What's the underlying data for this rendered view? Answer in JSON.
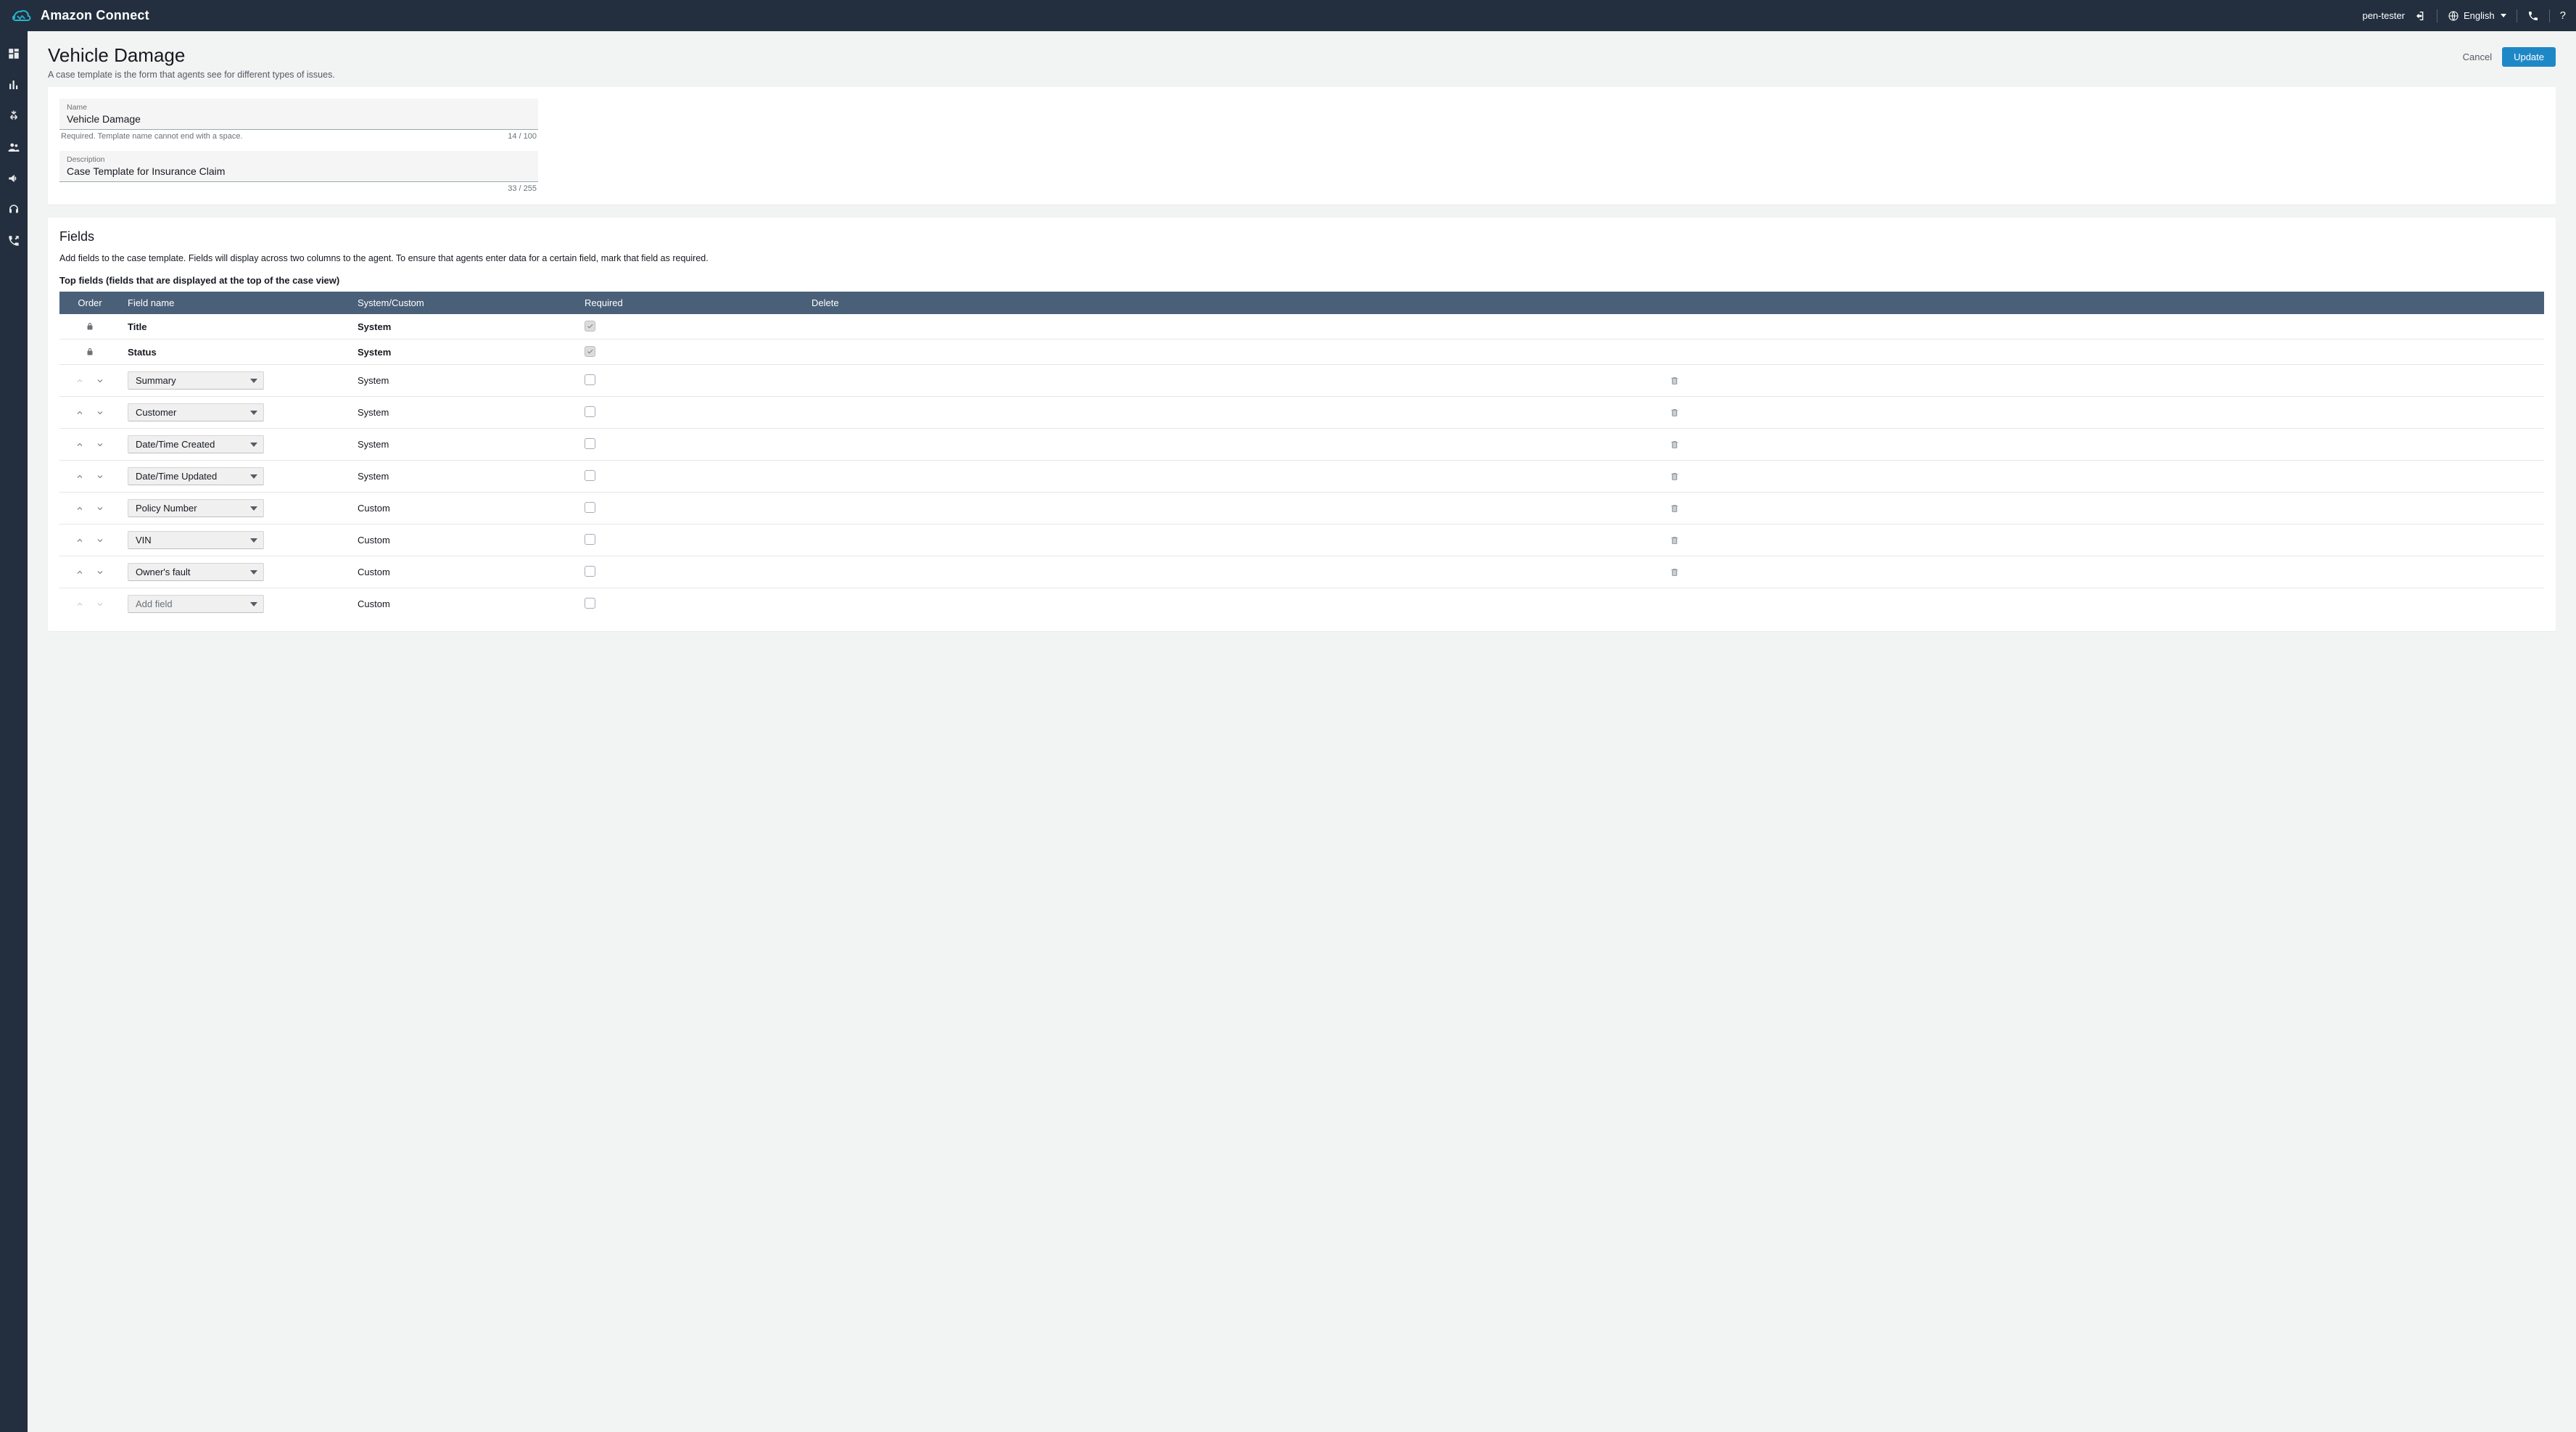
{
  "header": {
    "brand": "Amazon Connect",
    "user": "pen-tester",
    "language": "English"
  },
  "page": {
    "title": "Vehicle Damage",
    "subtitle": "A case template is the form that agents see for different types of issues.",
    "cancel": "Cancel",
    "update": "Update"
  },
  "details": {
    "name_label": "Name",
    "name_value": "Vehicle Damage",
    "name_hint": "Required.  Template name cannot end with a space.",
    "name_counter": "14 / 100",
    "desc_label": "Description",
    "desc_value": "Case Template for Insurance Claim",
    "desc_counter": "33 / 255"
  },
  "fields_section": {
    "heading": "Fields",
    "description": "Add fields to the case template. Fields will display across two columns to the agent. To ensure that agents enter data for a certain field, mark that field as required.",
    "top_caption": "Top fields (fields that are displayed at the top of the case view)",
    "cols": {
      "order": "Order",
      "name": "Field name",
      "sc": "System/Custom",
      "req": "Required",
      "del": "Delete"
    },
    "rows": [
      {
        "locked": true,
        "name": "Title",
        "dropdown": false,
        "sc": "System",
        "req_locked": true,
        "deletable": false,
        "up": false,
        "down": false
      },
      {
        "locked": true,
        "name": "Status",
        "dropdown": false,
        "sc": "System",
        "req_locked": true,
        "deletable": false,
        "up": false,
        "down": false
      },
      {
        "locked": false,
        "name": "Summary",
        "dropdown": true,
        "sc": "System",
        "req_locked": false,
        "deletable": true,
        "up": false,
        "down": true
      },
      {
        "locked": false,
        "name": "Customer",
        "dropdown": true,
        "sc": "System",
        "req_locked": false,
        "deletable": true,
        "up": true,
        "down": true
      },
      {
        "locked": false,
        "name": "Date/Time Created",
        "dropdown": true,
        "sc": "System",
        "req_locked": false,
        "deletable": true,
        "up": true,
        "down": true
      },
      {
        "locked": false,
        "name": "Date/Time Updated",
        "dropdown": true,
        "sc": "System",
        "req_locked": false,
        "deletable": true,
        "up": true,
        "down": true
      },
      {
        "locked": false,
        "name": "Policy Number",
        "dropdown": true,
        "sc": "Custom",
        "req_locked": false,
        "deletable": true,
        "up": true,
        "down": true
      },
      {
        "locked": false,
        "name": "VIN",
        "dropdown": true,
        "sc": "Custom",
        "req_locked": false,
        "deletable": true,
        "up": true,
        "down": true
      },
      {
        "locked": false,
        "name": "Owner's fault",
        "dropdown": true,
        "sc": "Custom",
        "req_locked": false,
        "deletable": true,
        "up": true,
        "down": true
      },
      {
        "locked": false,
        "name": "Add field",
        "dropdown": true,
        "placeholder": true,
        "sc": "Custom",
        "req_locked": false,
        "deletable": false,
        "up": false,
        "down": false
      }
    ]
  }
}
